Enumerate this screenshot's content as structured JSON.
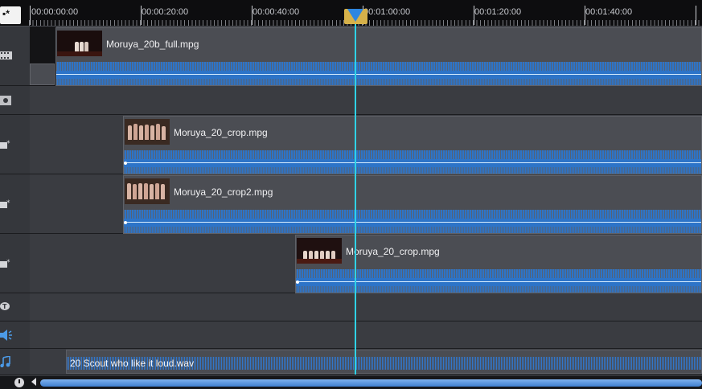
{
  "ruler": {
    "timecodes": [
      "00:00:00:00",
      "00:00:20:00",
      "00:00:40:00",
      "00:01:00:00",
      "00:01:20:00",
      "00:01:40:00"
    ]
  },
  "tracks": {
    "video_main": {
      "icon": "film-strip-icon",
      "clip_name": "Moruya_20b_full.mpg"
    },
    "overlay_1": {
      "icon": "overlay-track-icon",
      "clip_name": "Moruya_20_crop.mpg"
    },
    "overlay_2": {
      "icon": "overlay-track-icon",
      "clip_name": "Moruya_20_crop2.mpg"
    },
    "overlay_3": {
      "icon": "overlay-track-icon",
      "clip_name": "Moruya_20_crop.mpg"
    },
    "title": {
      "icon": "title-track-icon"
    },
    "voice": {
      "icon": "voice-track-icon"
    },
    "music": {
      "icon": "music-note-icon",
      "clip_name": "20 Scout who like it loud.wav"
    }
  },
  "colors": {
    "audio_blue": "#2d74c8",
    "playhead": "#2fd3e6",
    "playhead_marker": "#d6b14a"
  }
}
